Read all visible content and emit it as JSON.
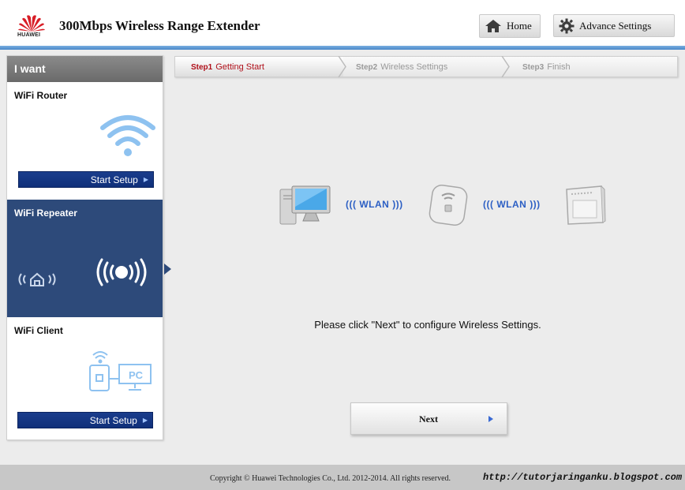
{
  "header": {
    "brand": "HUAWEI",
    "title": "300Mbps Wireless Range Extender",
    "home_label": "Home",
    "advance_label": "Advance Settings"
  },
  "sidebar": {
    "heading": "I want",
    "modes": [
      {
        "label": "WiFi Router",
        "button": "Start Setup",
        "icon": "wifi-signal-icon",
        "selected": false
      },
      {
        "label": "WiFi Repeater",
        "icon": "repeater-signal-icon",
        "selected": true
      },
      {
        "label": "WiFi Client",
        "button": "Start Setup",
        "icon": "client-pc-icon",
        "selected": false
      }
    ]
  },
  "steps": [
    {
      "num": "Step1",
      "label": "Getting Start",
      "active": true
    },
    {
      "num": "Step2",
      "label": "Wireless Settings",
      "active": false
    },
    {
      "num": "Step3",
      "label": "Finish",
      "active": false
    }
  ],
  "diagram": {
    "wlan1": "WLAN",
    "wlan2": "WLAN",
    "icons": [
      "computer-icon",
      "extender-icon",
      "router-icon"
    ]
  },
  "main": {
    "instruction": "Please click \"Next\" to configure Wireless Settings.",
    "next_label": "Next"
  },
  "footer": {
    "copyright": "Copyright © Huawei Technologies Co., Ltd. 2012-2014. All rights reserved.",
    "watermark": "http://tutorjaringanku.blogspot.com"
  },
  "colors": {
    "accent_blue": "#2d4a7a",
    "button_blue": "#10307a",
    "active_step": "#b0101a",
    "wlan_text": "#2c5fc4",
    "header_bar": "#4a88c9"
  }
}
